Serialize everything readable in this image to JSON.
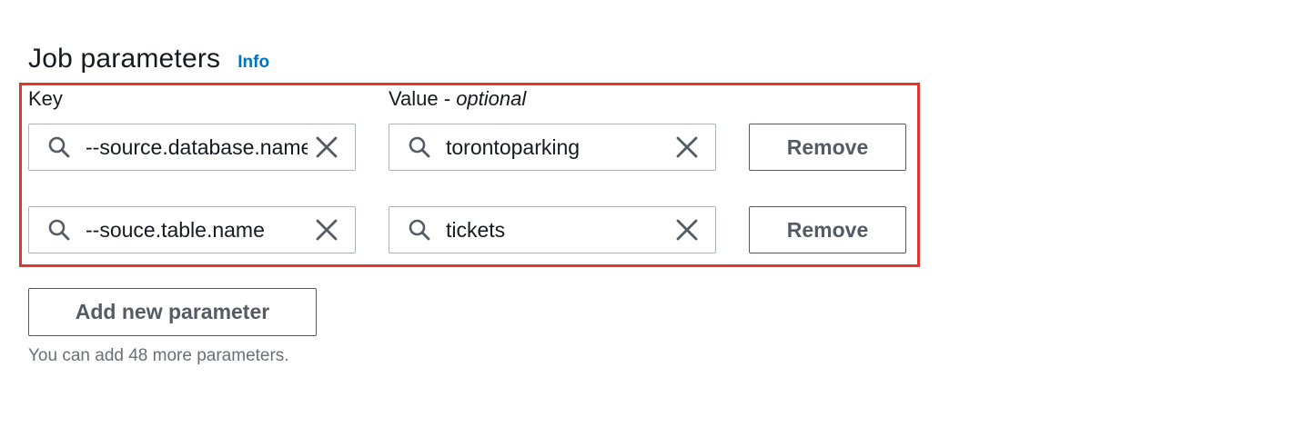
{
  "section": {
    "title": "Job parameters",
    "info_label": "Info"
  },
  "columns": {
    "key_label": "Key",
    "value_label_main": "Value - ",
    "value_label_optional": "optional"
  },
  "parameters": [
    {
      "key": "--source.database.name",
      "value": "torontoparking",
      "remove_label": "Remove"
    },
    {
      "key": "--souce.table.name",
      "value": "tickets",
      "remove_label": "Remove"
    }
  ],
  "add_button_label": "Add new parameter",
  "hint": "You can add 48 more parameters.",
  "icons": {
    "search": "search-icon",
    "clear": "close-icon"
  },
  "colors": {
    "highlight_border": "#e2352b",
    "info_link": "#0073bb",
    "button_text": "#545b64",
    "hint_text": "#687078"
  }
}
